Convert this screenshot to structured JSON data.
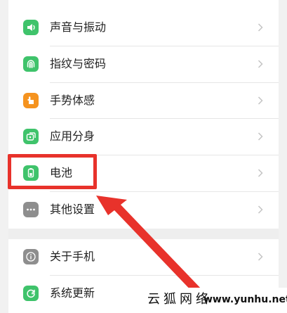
{
  "settings": {
    "items": [
      {
        "label": "声音与振动",
        "icon": "speaker-icon",
        "icon_color": "#3fc36b"
      },
      {
        "label": "指纹与密码",
        "icon": "fingerprint-icon",
        "icon_color": "#3fc36b"
      },
      {
        "label": "手势体感",
        "icon": "hand-gesture-icon",
        "icon_color": "#f5931f"
      },
      {
        "label": "应用分身",
        "icon": "app-clone-icon",
        "icon_color": "#3fc36b"
      },
      {
        "label": "电池",
        "icon": "battery-icon",
        "icon_color": "#3fc36b"
      },
      {
        "label": "其他设置",
        "icon": "more-dots-icon",
        "icon_color": "#8e8e8e"
      },
      {
        "label": "关于手机",
        "icon": "info-icon",
        "icon_color": "#8e8e8e"
      },
      {
        "label": "系统更新",
        "icon": "update-icon",
        "icon_color": "#3fc36b"
      }
    ]
  },
  "annotation": {
    "highlight_color": "#e8322b",
    "arrow_color": "#e8322b"
  },
  "watermark": {
    "text_cn": "云狐网络",
    "url": "www.yunhu.net"
  }
}
